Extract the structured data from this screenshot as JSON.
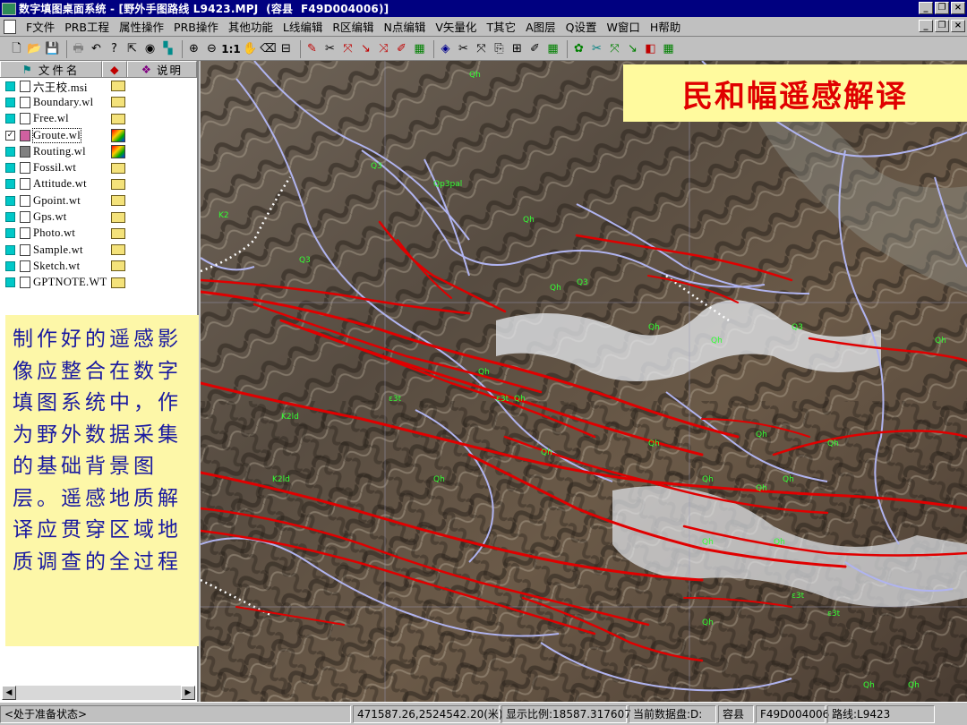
{
  "window": {
    "title": "数字填图桌面系统 - [野外手图路线 L9423.MPJ  (容县  F49D004006)]"
  },
  "menu": {
    "items": [
      "F文件",
      "PRB工程",
      "属性操作",
      "PRB操作",
      "其他功能",
      "L线编辑",
      "R区编辑",
      "N点编辑",
      "V矢量化",
      "T其它",
      "A图层",
      "Q设置",
      "W窗口",
      "H帮助"
    ]
  },
  "toolbar": {
    "scale_label": "1:1"
  },
  "sidepanel": {
    "headers": {
      "name": "文件名",
      "desc": "说明"
    },
    "files": [
      {
        "name": "六王校.msi",
        "checked": false,
        "icon": "folder-icon"
      },
      {
        "name": "Boundary.wl",
        "checked": false,
        "icon": "folder-icon"
      },
      {
        "name": "Free.wl",
        "checked": false,
        "icon": "folder-icon"
      },
      {
        "name": "Groute.wl",
        "checked": true,
        "icon": "multicolor-layer-icon"
      },
      {
        "name": "Routing.wl",
        "checked": false,
        "icon": "multicolor-layer-icon"
      },
      {
        "name": "Fossil.wt",
        "checked": false,
        "icon": "folder-icon"
      },
      {
        "name": "Attitude.wt",
        "checked": false,
        "icon": "folder-icon"
      },
      {
        "name": "Gpoint.wt",
        "checked": false,
        "icon": "folder-icon"
      },
      {
        "name": "Gps.wt",
        "checked": false,
        "icon": "folder-icon"
      },
      {
        "name": "Photo.wt",
        "checked": false,
        "icon": "folder-icon"
      },
      {
        "name": "Sample.wt",
        "checked": false,
        "icon": "folder-icon"
      },
      {
        "name": "Sketch.wt",
        "checked": false,
        "icon": "folder-icon"
      },
      {
        "name": "GPTNOTE.WT",
        "checked": false,
        "icon": "folder-icon"
      }
    ]
  },
  "note": {
    "text": "制作好的遥感影像应整合在数字填图系统中，作为野外数据采集的基础背景图层。遥感地质解译应贯穿区域地质调查的全过程"
  },
  "map": {
    "title": "民和幅遥感解译",
    "fault_color": "#e00000",
    "boundary_color": "#b0b4f0",
    "labels": [
      "Qh",
      "Q3",
      "Qp3pal",
      "Qh",
      "K2",
      "Q3",
      "Qh",
      "Q3",
      "Qh",
      "Qh",
      "Q3",
      "Qh",
      "ε3t",
      "Qh",
      "K2ld",
      "Qh",
      "Qh",
      "Qh",
      "Qh",
      "Qh",
      "ε3t",
      "Qh",
      "K2ld",
      "Qh",
      "Qh",
      "Qh",
      "Qh",
      "Qh",
      "Qh",
      "ε3t",
      "ε3t",
      "Qh",
      "Qh",
      "Qh"
    ]
  },
  "status": {
    "state": "<处于准备状态>",
    "coords": "471587.26,2524542.20(米)",
    "scale": "显示比例:18587.317607",
    "disk": "当前数据盘:D:",
    "county": "容县",
    "sheet": "F49D004006",
    "route": "路线:L9423"
  }
}
